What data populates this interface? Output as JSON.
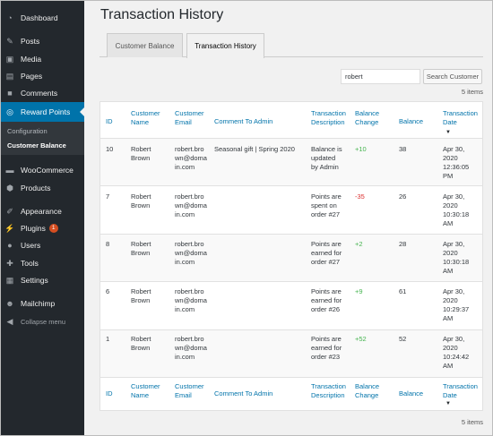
{
  "sidebar": {
    "items": [
      {
        "label": "Dashboard",
        "icon": "dashboard-icon"
      },
      {
        "label": "Posts",
        "icon": "pin-icon"
      },
      {
        "label": "Media",
        "icon": "media-icon"
      },
      {
        "label": "Pages",
        "icon": "pages-icon"
      },
      {
        "label": "Comments",
        "icon": "comment-icon"
      },
      {
        "label": "Reward Points",
        "icon": "search-icon"
      },
      {
        "label": "WooCommerce",
        "icon": "woo-icon"
      },
      {
        "label": "Products",
        "icon": "box-icon"
      },
      {
        "label": "Appearance",
        "icon": "brush-icon"
      },
      {
        "label": "Plugins",
        "icon": "plug-icon",
        "badge": "1"
      },
      {
        "label": "Users",
        "icon": "user-icon"
      },
      {
        "label": "Tools",
        "icon": "wrench-icon"
      },
      {
        "label": "Settings",
        "icon": "settings-icon"
      },
      {
        "label": "Mailchimp",
        "icon": "mailchimp-icon"
      },
      {
        "label": "Collapse menu",
        "icon": "collapse-icon"
      }
    ],
    "submenu": [
      "Configuration",
      "Customer Balance"
    ]
  },
  "page": {
    "title": "Transaction History",
    "tabs": [
      "Customer Balance",
      "Transaction History"
    ],
    "search_value": "robert",
    "search_button": "Search Customer",
    "count": "5 items"
  },
  "table": {
    "headers": [
      "ID",
      "Customer\nName",
      "Customer\nEmail",
      "Comment To Admin",
      "Transaction\nDescription",
      "Balance\nChange",
      "Balance",
      "Transaction\nDate"
    ],
    "rows": [
      {
        "id": "10",
        "name": "Robert\nBrown",
        "email": "robert.bro\nwn@doma\nin.com",
        "comment": "Seasonal gift | Spring 2020",
        "desc": "Balance is\nupdated\nby Admin",
        "change": "+10",
        "balance": "38",
        "date": "Apr 30,\n2020\n12:36:05\nPM"
      },
      {
        "id": "7",
        "name": "Robert\nBrown",
        "email": "robert.bro\nwn@doma\nin.com",
        "comment": "",
        "desc": "Points are\nspent on\norder #27",
        "change": "-35",
        "balance": "26",
        "date": "Apr 30,\n2020\n10:30:18\nAM"
      },
      {
        "id": "8",
        "name": "Robert\nBrown",
        "email": "robert.bro\nwn@doma\nin.com",
        "comment": "",
        "desc": "Points are\nearned for\norder #27",
        "change": "+2",
        "balance": "28",
        "date": "Apr 30,\n2020\n10:30:18\nAM"
      },
      {
        "id": "6",
        "name": "Robert\nBrown",
        "email": "robert.bro\nwn@doma\nin.com",
        "comment": "",
        "desc": "Points are\nearned for\norder #26",
        "change": "+9",
        "balance": "61",
        "date": "Apr 30,\n2020\n10:29:37\nAM"
      },
      {
        "id": "1",
        "name": "Robert\nBrown",
        "email": "robert.bro\nwn@doma\nin.com",
        "comment": "",
        "desc": "Points are\nearned for\norder #23",
        "change": "+52",
        "balance": "52",
        "date": "Apr 30,\n2020\n10:24:42\nAM"
      }
    ]
  },
  "colors": {
    "accent": "#0073aa",
    "sidebar": "#23282d",
    "positive": "#46b450",
    "negative": "#dc3232"
  }
}
